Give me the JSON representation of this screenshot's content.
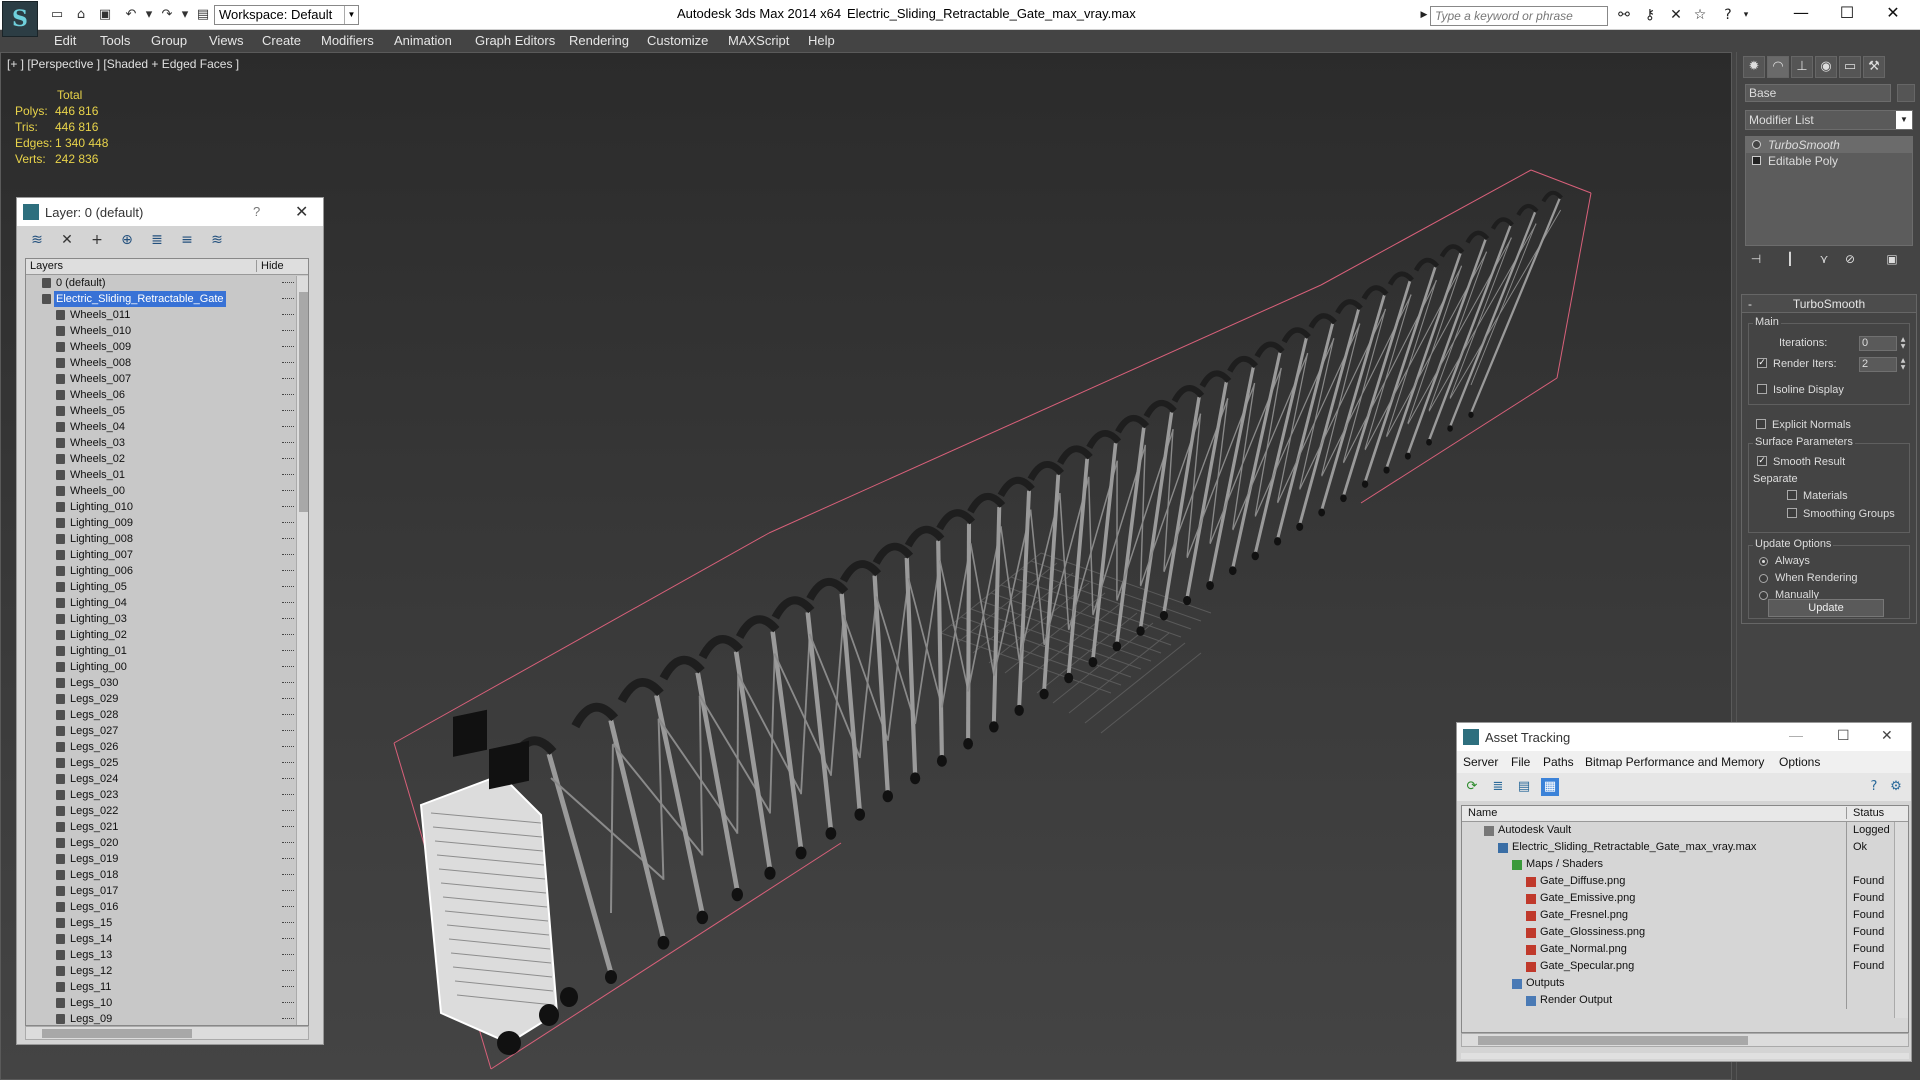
{
  "titlebar": {
    "app_logo": "S",
    "workspace": "Workspace: Default",
    "app_title": "Autodesk 3ds Max  2014 x64",
    "file_title": "Electric_Sliding_Retractable_Gate_max_vray.max",
    "search_placeholder": "Type a keyword or phrase"
  },
  "menu": [
    "Edit",
    "Tools",
    "Group",
    "Views",
    "Create",
    "Modifiers",
    "Animation",
    "Graph Editors",
    "Rendering",
    "Customize",
    "MAXScript",
    "Help"
  ],
  "viewport": {
    "label": "[+ ] [Perspective ] [Shaded + Edged Faces ]",
    "stats": {
      "total": "Total",
      "rows": [
        {
          "label": "Polys:",
          "value": "446 816"
        },
        {
          "label": "Tris:",
          "value": "446 816"
        },
        {
          "label": "Edges:",
          "value": "1 340 448"
        },
        {
          "label": "Verts:",
          "value": "242 836"
        }
      ]
    }
  },
  "layer_explorer": {
    "title": "Layer: 0 (default)",
    "help": "?",
    "col_layers": "Layers",
    "col_hide": "Hide",
    "rows": [
      {
        "name": "0 (default)",
        "level": 1
      },
      {
        "name": "Electric_Sliding_Retractable_Gate",
        "level": 1,
        "selected": true
      },
      {
        "name": "Wheels_011",
        "level": 2
      },
      {
        "name": "Wheels_010",
        "level": 2
      },
      {
        "name": "Wheels_009",
        "level": 2
      },
      {
        "name": "Wheels_008",
        "level": 2
      },
      {
        "name": "Wheels_007",
        "level": 2
      },
      {
        "name": "Wheels_06",
        "level": 2
      },
      {
        "name": "Wheels_05",
        "level": 2
      },
      {
        "name": "Wheels_04",
        "level": 2
      },
      {
        "name": "Wheels_03",
        "level": 2
      },
      {
        "name": "Wheels_02",
        "level": 2
      },
      {
        "name": "Wheels_01",
        "level": 2
      },
      {
        "name": "Wheels_00",
        "level": 2
      },
      {
        "name": "Lighting_010",
        "level": 2
      },
      {
        "name": "Lighting_009",
        "level": 2
      },
      {
        "name": "Lighting_008",
        "level": 2
      },
      {
        "name": "Lighting_007",
        "level": 2
      },
      {
        "name": "Lighting_006",
        "level": 2
      },
      {
        "name": "Lighting_05",
        "level": 2
      },
      {
        "name": "Lighting_04",
        "level": 2
      },
      {
        "name": "Lighting_03",
        "level": 2
      },
      {
        "name": "Lighting_02",
        "level": 2
      },
      {
        "name": "Lighting_01",
        "level": 2
      },
      {
        "name": "Lighting_00",
        "level": 2
      },
      {
        "name": "Legs_030",
        "level": 2
      },
      {
        "name": "Legs_029",
        "level": 2
      },
      {
        "name": "Legs_028",
        "level": 2
      },
      {
        "name": "Legs_027",
        "level": 2
      },
      {
        "name": "Legs_026",
        "level": 2
      },
      {
        "name": "Legs_025",
        "level": 2
      },
      {
        "name": "Legs_024",
        "level": 2
      },
      {
        "name": "Legs_023",
        "level": 2
      },
      {
        "name": "Legs_022",
        "level": 2
      },
      {
        "name": "Legs_021",
        "level": 2
      },
      {
        "name": "Legs_020",
        "level": 2
      },
      {
        "name": "Legs_019",
        "level": 2
      },
      {
        "name": "Legs_018",
        "level": 2
      },
      {
        "name": "Legs_017",
        "level": 2
      },
      {
        "name": "Legs_016",
        "level": 2
      },
      {
        "name": "Legs_15",
        "level": 2
      },
      {
        "name": "Legs_14",
        "level": 2
      },
      {
        "name": "Legs_13",
        "level": 2
      },
      {
        "name": "Legs_12",
        "level": 2
      },
      {
        "name": "Legs_11",
        "level": 2
      },
      {
        "name": "Legs_10",
        "level": 2
      },
      {
        "name": "Legs_09",
        "level": 2
      }
    ]
  },
  "command_panel": {
    "object_name": "Base",
    "modifier_list": "Modifier List",
    "stack": [
      "TurboSmooth",
      "Editable Poly"
    ],
    "turbosmooth": {
      "title": "TurboSmooth",
      "collapse": "-",
      "main": "Main",
      "iterations_label": "Iterations:",
      "iterations": "0",
      "render_iters_label": "Render Iters:",
      "render_iters": "2",
      "isoline": "Isoline Display",
      "explicit_normals": "Explicit Normals",
      "surface_params": "Surface Parameters",
      "smooth_result": "Smooth Result",
      "separate": "Separate",
      "materials": "Materials",
      "smoothing_groups": "Smoothing Groups",
      "update_options": "Update Options",
      "always": "Always",
      "when_rendering": "When Rendering",
      "manually": "Manually",
      "update": "Update"
    }
  },
  "asset_tracking": {
    "title": "Asset Tracking",
    "menu": [
      "Server",
      "File",
      "Paths",
      "Bitmap Performance and Memory",
      "Options"
    ],
    "col_name": "Name",
    "col_status": "Status",
    "rows": [
      {
        "name": "Autodesk Vault",
        "status": "Logged",
        "kind": "vault",
        "level": 0
      },
      {
        "name": "Electric_Sliding_Retractable_Gate_max_vray.max",
        "status": "Ok",
        "kind": "max",
        "level": 1
      },
      {
        "name": "Maps / Shaders",
        "status": "",
        "kind": "maps",
        "level": 2
      },
      {
        "name": "Gate_Diffuse.png",
        "status": "Found",
        "kind": "png",
        "level": 3
      },
      {
        "name": "Gate_Emissive.png",
        "status": "Found",
        "kind": "png",
        "level": 3
      },
      {
        "name": "Gate_Fresnel.png",
        "status": "Found",
        "kind": "png",
        "level": 3
      },
      {
        "name": "Gate_Glossiness.png",
        "status": "Found",
        "kind": "png",
        "level": 3
      },
      {
        "name": "Gate_Normal.png",
        "status": "Found",
        "kind": "png",
        "level": 3
      },
      {
        "name": "Gate_Specular.png",
        "status": "Found",
        "kind": "png",
        "level": 3
      },
      {
        "name": "Outputs",
        "status": "",
        "kind": "out",
        "level": 2
      },
      {
        "name": "Render Output",
        "status": "",
        "kind": "out",
        "level": 3
      }
    ]
  },
  "colors": {
    "stats_text": "#e8d34a",
    "selection": "#3872d6",
    "bbox": "#d8607a"
  }
}
